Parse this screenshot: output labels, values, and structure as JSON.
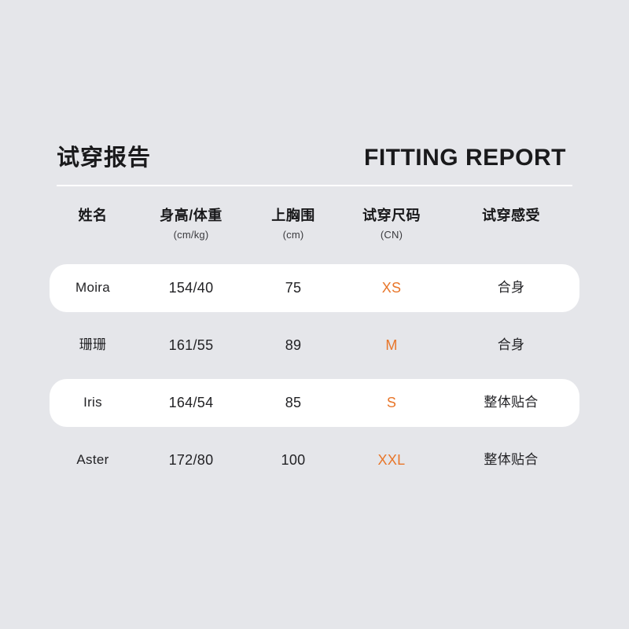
{
  "header": {
    "title_cn": "试穿报告",
    "title_en": "FITTING REPORT"
  },
  "colors": {
    "background": "#e5e6ea",
    "row_highlight": "#ffffff",
    "size_accent": "#e8762a",
    "text": "#222225",
    "divider": "#ffffff"
  },
  "table": {
    "columns": [
      {
        "label": "姓名",
        "unit": ""
      },
      {
        "label": "身高/体重",
        "unit": "(cm/kg)"
      },
      {
        "label": "上胸围",
        "unit": "(cm)"
      },
      {
        "label": "试穿尺码",
        "unit": "(CN)"
      },
      {
        "label": "试穿感受",
        "unit": ""
      }
    ],
    "rows": [
      {
        "name": "Moira",
        "height_weight": "154/40",
        "bust": "75",
        "size": "XS",
        "feeling": "合身",
        "highlighted": true
      },
      {
        "name": "珊珊",
        "height_weight": "161/55",
        "bust": "89",
        "size": "M",
        "feeling": "合身",
        "highlighted": false
      },
      {
        "name": "Iris",
        "height_weight": "164/54",
        "bust": "85",
        "size": "S",
        "feeling": "整体贴合",
        "highlighted": true
      },
      {
        "name": "Aster",
        "height_weight": "172/80",
        "bust": "100",
        "size": "XXL",
        "feeling": "整体贴合",
        "highlighted": false
      }
    ]
  }
}
